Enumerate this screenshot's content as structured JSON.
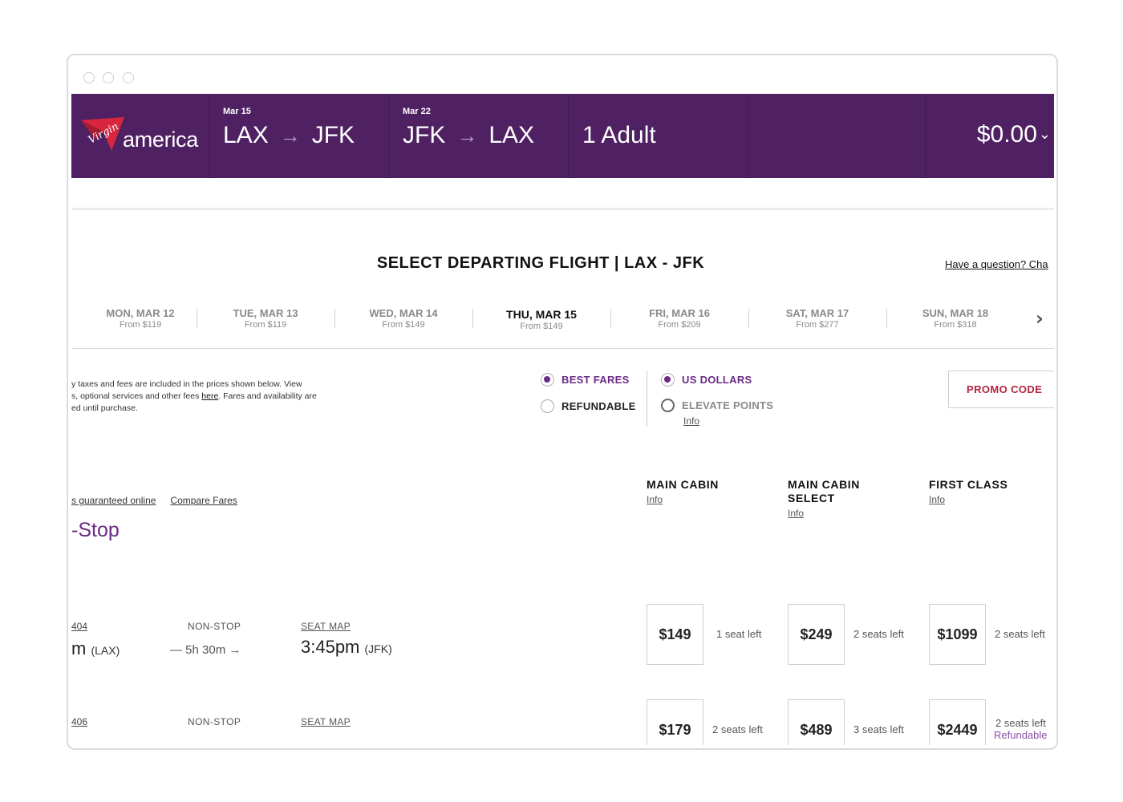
{
  "header": {
    "brand_script": "Virgin",
    "brand_word": "america",
    "depart": {
      "date": "Mar 15",
      "from": "LAX",
      "arrow": "→",
      "to": "JFK"
    },
    "return": {
      "date": "Mar 22",
      "from": "JFK",
      "arrow": "→",
      "to": "LAX"
    },
    "passengers": "1 Adult",
    "total": "$0.00",
    "total_chevron": "⌄"
  },
  "title": "SELECT DEPARTING FLIGHT | LAX - JFK",
  "question_link": "Have a question? Cha",
  "days": [
    {
      "label": "MON, MAR 12",
      "from": "From $119"
    },
    {
      "label": "TUE, MAR 13",
      "from": "From $119"
    },
    {
      "label": "WED, MAR 14",
      "from": "From $149"
    },
    {
      "label": "THU, MAR 15",
      "from": "From $149"
    },
    {
      "label": "FRI, MAR 16",
      "from": "From $209"
    },
    {
      "label": "SAT, MAR 17",
      "from": "From $277"
    },
    {
      "label": "SUN, MAR 18",
      "from": "From $318"
    }
  ],
  "next_glyph": "›",
  "note": {
    "line1": "y taxes and fees are included in the prices shown below. View",
    "line2_pre": "s, optional services and other fees ",
    "line2_link": "here",
    "line2_post": ". Fares and availability are",
    "line3": "ed until purchase."
  },
  "fare_options": {
    "best": "BEST FARES",
    "refundable": "REFUNDABLE"
  },
  "currency_options": {
    "usd": "US DOLLARS",
    "points": "ELEVATE POINTS",
    "info": "Info"
  },
  "promo_label": "PROMO CODE",
  "links": {
    "guaranteed": "s guaranteed online",
    "compare": "Compare Fares"
  },
  "section_label": "-Stop",
  "cabins": [
    {
      "name": "MAIN CABIN",
      "info": "Info"
    },
    {
      "name_line1": "MAIN CABIN",
      "name_line2": "SELECT",
      "info": "Info"
    },
    {
      "name": "FIRST CLASS",
      "info": "Info"
    }
  ],
  "flights": [
    {
      "number": "404",
      "stops": "NON-STOP",
      "seat_map": "SEAT MAP",
      "depart_time": "m",
      "depart_code": "(LAX)",
      "duration": "— 5h 30m →",
      "arrive_time": "3:45pm",
      "arrive_code": "(JFK)",
      "fares": [
        {
          "price": "$149",
          "seats": "1 seat left"
        },
        {
          "price": "$249",
          "seats": "2 seats left"
        },
        {
          "price": "$1099",
          "seats": "2 seats left"
        }
      ]
    },
    {
      "number": "406",
      "stops": "NON-STOP",
      "seat_map": "SEAT MAP",
      "fares": [
        {
          "price": "$179",
          "seats": "2 seats left"
        },
        {
          "price": "$489",
          "seats": "3 seats left"
        },
        {
          "price": "$2449",
          "seats": "2 seats left",
          "extra": "Refundable"
        }
      ]
    }
  ],
  "colors": {
    "header_bg": "#4f2162",
    "accent_purple": "#6b2a86",
    "promo_red": "#b3243c"
  }
}
